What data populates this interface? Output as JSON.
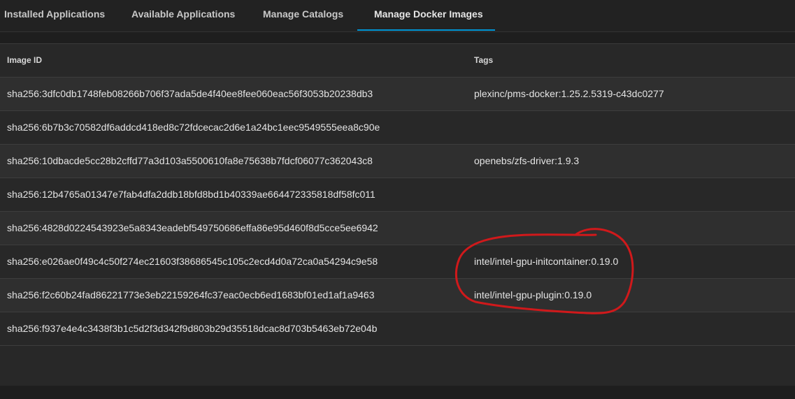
{
  "tabs": [
    {
      "label": "Installed Applications",
      "active": false
    },
    {
      "label": "Available Applications",
      "active": false
    },
    {
      "label": "Manage Catalogs",
      "active": false
    },
    {
      "label": "Manage Docker Images",
      "active": true
    }
  ],
  "table": {
    "headers": {
      "image_id": "Image ID",
      "tags": "Tags"
    },
    "rows": [
      {
        "image_id": "sha256:3dfc0db1748feb08266b706f37ada5de4f40ee8fee060eac56f3053b20238db3",
        "tags": "plexinc/pms-docker:1.25.2.5319-c43dc0277"
      },
      {
        "image_id": "sha256:6b7b3c70582df6addcd418ed8c72fdcecac2d6e1a24bc1eec9549555eea8c90e",
        "tags": ""
      },
      {
        "image_id": "sha256:10dbacde5cc28b2cffd77a3d103a5500610fa8e75638b7fdcf06077c362043c8",
        "tags": "openebs/zfs-driver:1.9.3"
      },
      {
        "image_id": "sha256:12b4765a01347e7fab4dfa2ddb18bfd8bd1b40339ae664472335818df58fc011",
        "tags": ""
      },
      {
        "image_id": "sha256:4828d0224543923e5a8343eadebf549750686effa86e95d460f8d5cce5ee6942",
        "tags": ""
      },
      {
        "image_id": "sha256:e026ae0f49c4c50f274ec21603f38686545c105c2ecd4d0a72ca0a54294c9e58",
        "tags": "intel/intel-gpu-initcontainer:0.19.0"
      },
      {
        "image_id": "sha256:f2c60b24fad86221773e3eb22159264fc37eac0ecb6ed1683bf01ed1af1a9463",
        "tags": "intel/intel-gpu-plugin:0.19.0"
      },
      {
        "image_id": "sha256:f937e4e4c3438f3b1c5d2f3d342f9d803b29d35518dcac8d703b5463eb72e04b",
        "tags": ""
      }
    ]
  },
  "colors": {
    "accent": "#0095d5",
    "annotation": "#d0191b"
  }
}
